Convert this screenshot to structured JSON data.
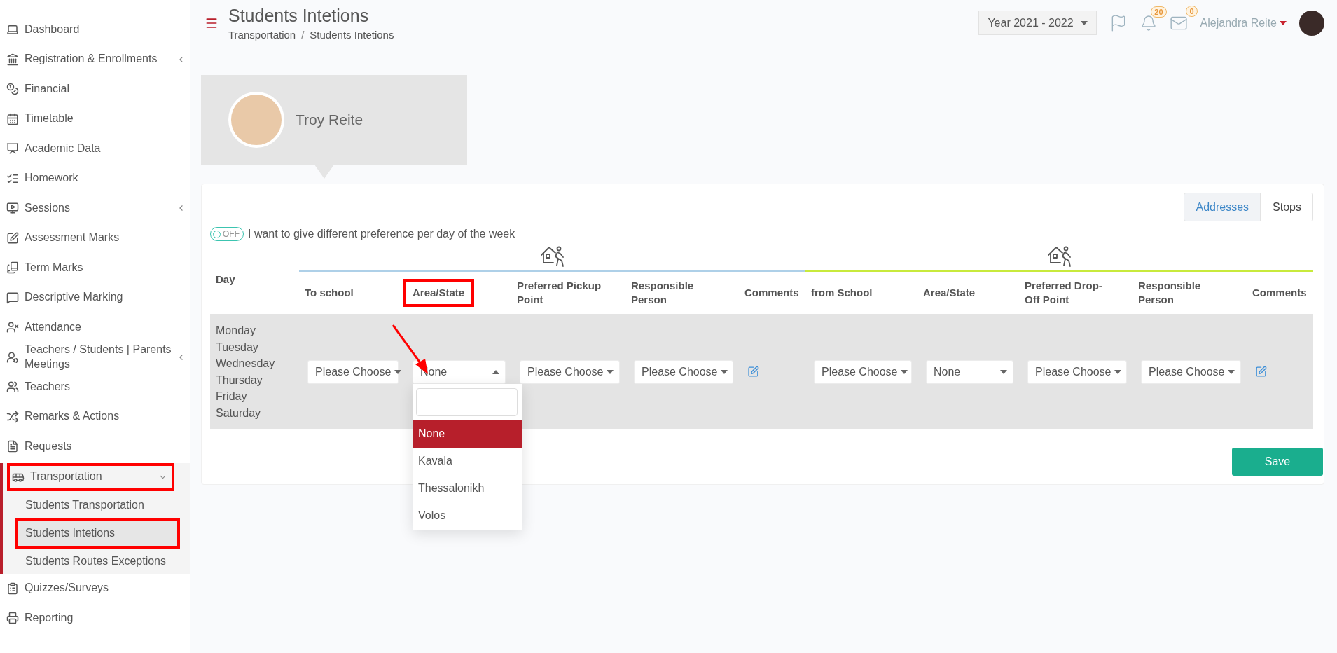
{
  "sidebar": {
    "items": [
      {
        "label": "Dashboard",
        "selected": false
      },
      {
        "label": "Registration & Enrollments",
        "selected": false,
        "expanded": false
      },
      {
        "label": "Financial",
        "selected": false
      },
      {
        "label": "Timetable",
        "selected": false
      },
      {
        "label": "Academic Data",
        "selected": false
      },
      {
        "label": "Homework",
        "selected": false
      },
      {
        "label": "Sessions",
        "selected": false,
        "expanded": false
      },
      {
        "label": "Assessment Marks",
        "selected": false
      },
      {
        "label": "Term Marks",
        "selected": false
      },
      {
        "label": "Descriptive Marking",
        "selected": false
      },
      {
        "label": "Attendance",
        "selected": false
      },
      {
        "label": "Teachers / Students | Parents Meetings",
        "selected": false,
        "expanded": false
      },
      {
        "label": "Teachers",
        "selected": false
      },
      {
        "label": "Remarks & Actions",
        "selected": false
      },
      {
        "label": "Requests",
        "selected": false
      },
      {
        "label": "Transportation",
        "selected": true,
        "expanded": true,
        "highlight": true,
        "children": [
          {
            "label": "Students Transportation",
            "selected": false,
            "highlight": false
          },
          {
            "label": "Students Intetions",
            "selected": true,
            "highlight": true
          },
          {
            "label": "Students Routes Exceptions",
            "selected": false,
            "highlight": false
          }
        ]
      },
      {
        "label": "Quizzes/Surveys",
        "selected": false
      },
      {
        "label": "Reporting",
        "selected": false
      }
    ]
  },
  "header": {
    "title": "Students Intetions",
    "breadcrumb": [
      "Transportation",
      "Students Intetions"
    ],
    "separator": "/",
    "year": "Year 2021 - 2022",
    "notifications": "20",
    "messages": "0",
    "user": "Alejandra Reite"
  },
  "student": {
    "name": "Troy Reite"
  },
  "view_tabs": [
    {
      "label": "Addresses",
      "selected": true
    },
    {
      "label": "Stops",
      "selected": false
    }
  ],
  "toggle": {
    "label": "OFF",
    "on": false,
    "text": "I want to give different preference per day of the week"
  },
  "table": {
    "day_header": "Day",
    "days": [
      "Monday",
      "Tuesday",
      "Wednesday",
      "Thursday",
      "Friday",
      "Saturday"
    ],
    "groups": [
      {
        "color": "#aed0e8",
        "columns": [
          {
            "label": "To school",
            "kind": "select",
            "value": "Please Choose",
            "highlight": false,
            "open": false
          },
          {
            "label": "Area/State",
            "kind": "select",
            "value": "None",
            "highlight": true,
            "open": true,
            "options": [
              {
                "label": "None",
                "selected": true
              },
              {
                "label": "Kavala",
                "selected": false
              },
              {
                "label": "Thessalonikh",
                "selected": false
              },
              {
                "label": "Volos",
                "selected": false
              }
            ]
          },
          {
            "label": "Preferred Pickup Point",
            "kind": "select",
            "value": "Please Choose",
            "highlight": false,
            "open": false
          },
          {
            "label": "Responsible Person",
            "kind": "select",
            "value": "Please Choose",
            "highlight": false,
            "open": false
          },
          {
            "label": "Comments",
            "kind": "comment",
            "highlight": false
          }
        ]
      },
      {
        "color": "#c8ea3c",
        "columns": [
          {
            "label": "from School",
            "kind": "select",
            "value": "Please Choose",
            "highlight": false,
            "open": false
          },
          {
            "label": "Area/State",
            "kind": "select",
            "value": "None",
            "highlight": false,
            "open": false
          },
          {
            "label": "Preferred Drop-Off Point",
            "kind": "select",
            "value": "Please Choose",
            "highlight": false,
            "open": false
          },
          {
            "label": "Responsible Person",
            "kind": "select",
            "value": "Please Choose",
            "highlight": false,
            "open": false
          },
          {
            "label": "Comments",
            "kind": "comment",
            "highlight": false
          }
        ]
      }
    ]
  },
  "save": "Save"
}
